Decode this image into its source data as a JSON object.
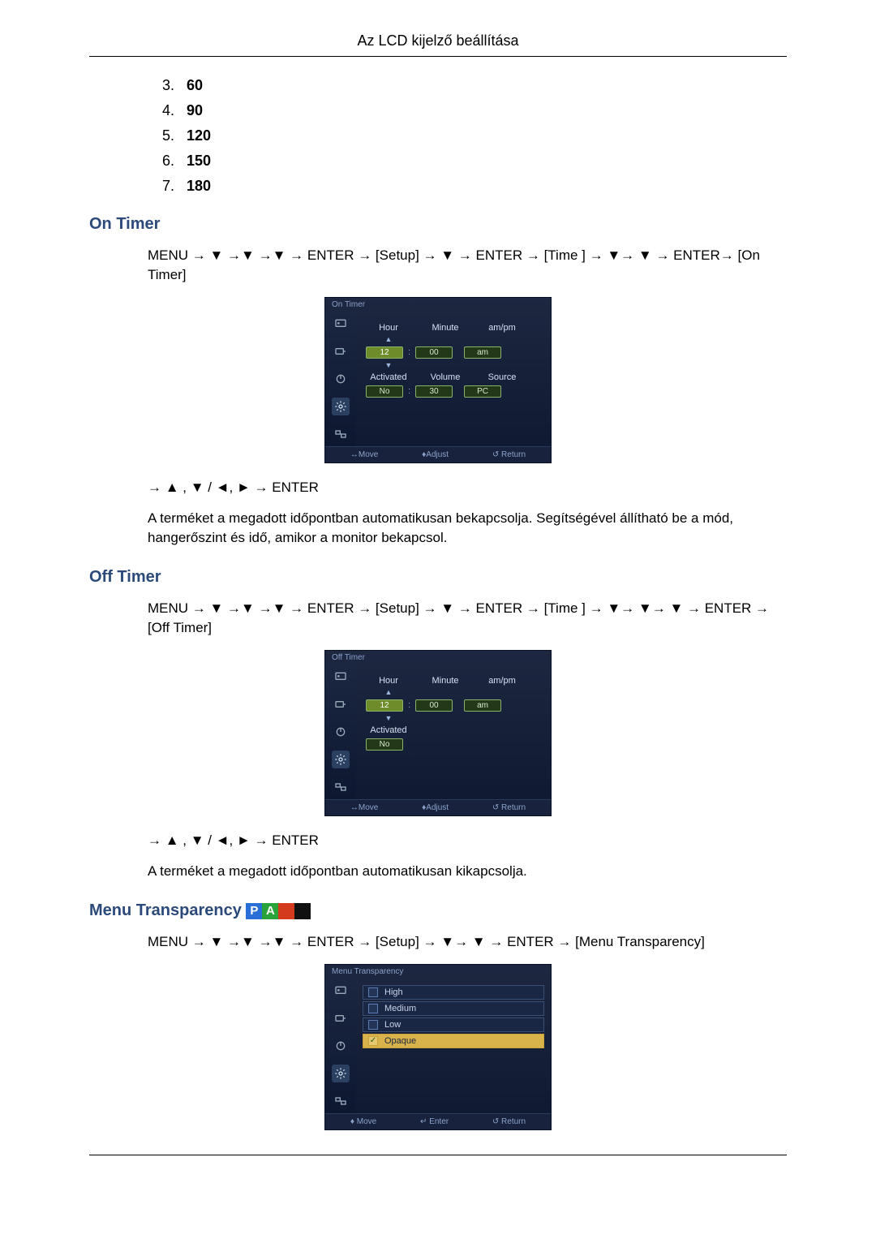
{
  "header": "Az LCD kijelző beállítása",
  "list": {
    "items": [
      {
        "num": "3.",
        "val": "60"
      },
      {
        "num": "4.",
        "val": "90"
      },
      {
        "num": "5.",
        "val": "120"
      },
      {
        "num": "6.",
        "val": "150"
      },
      {
        "num": "7.",
        "val": "180"
      }
    ]
  },
  "on_timer": {
    "heading": "On Timer",
    "path": "MENU → ▼ →▼ →▼ → ENTER → [Setup] → ▼ → ENTER → [Time ] → ▼→ ▼ → ENTER→ [On Timer]",
    "post_path": "→ ▲ , ▼ / ◄, ► → ENTER",
    "desc": "A terméket a megadott időpontban automatikusan bekapcsolja. Segítségével állítható be a mód, hangerőszint és idő, amikor a monitor bekapcsol.",
    "osd": {
      "title": "On Timer",
      "labels": {
        "hour": "Hour",
        "minute": "Minute",
        "ampm": "am/pm",
        "activated": "Activated",
        "volume": "Volume",
        "source": "Source"
      },
      "values": {
        "hour": "12",
        "minute": "00",
        "ampm": "am",
        "activated": "No",
        "volume": "30",
        "source": "PC"
      },
      "foot": {
        "move": "↔Move",
        "adjust": "♦Adjust",
        "return": "↺ Return"
      }
    }
  },
  "off_timer": {
    "heading": "Off Timer",
    "path": "MENU → ▼ →▼ →▼ → ENTER → [Setup] → ▼ → ENTER → [Time ] → ▼→ ▼→ ▼ → ENTER → [Off Timer]",
    "post_path": "→ ▲ , ▼ / ◄, ► → ENTER",
    "desc": "A terméket a megadott időpontban automatikusan kikapcsolja.",
    "osd": {
      "title": "Off Timer",
      "labels": {
        "hour": "Hour",
        "minute": "Minute",
        "ampm": "am/pm",
        "activated": "Activated"
      },
      "values": {
        "hour": "12",
        "minute": "00",
        "ampm": "am",
        "activated": "No"
      },
      "foot": {
        "move": "↔Move",
        "adjust": "♦Adjust",
        "return": "↺ Return"
      }
    }
  },
  "menu_transparency": {
    "heading": "Menu Transparency",
    "badges": [
      "P",
      "A"
    ],
    "path": "MENU → ▼ →▼ →▼ → ENTER → [Setup] → ▼→ ▼ → ENTER → [Menu Transparency]",
    "osd": {
      "title": "Menu Transparency",
      "items": [
        {
          "label": "High",
          "selected": false
        },
        {
          "label": "Medium",
          "selected": false
        },
        {
          "label": "Low",
          "selected": false
        },
        {
          "label": "Opaque",
          "selected": true
        }
      ],
      "foot": {
        "move": "♦ Move",
        "enter": "↵ Enter",
        "return": "↺ Return"
      }
    }
  }
}
